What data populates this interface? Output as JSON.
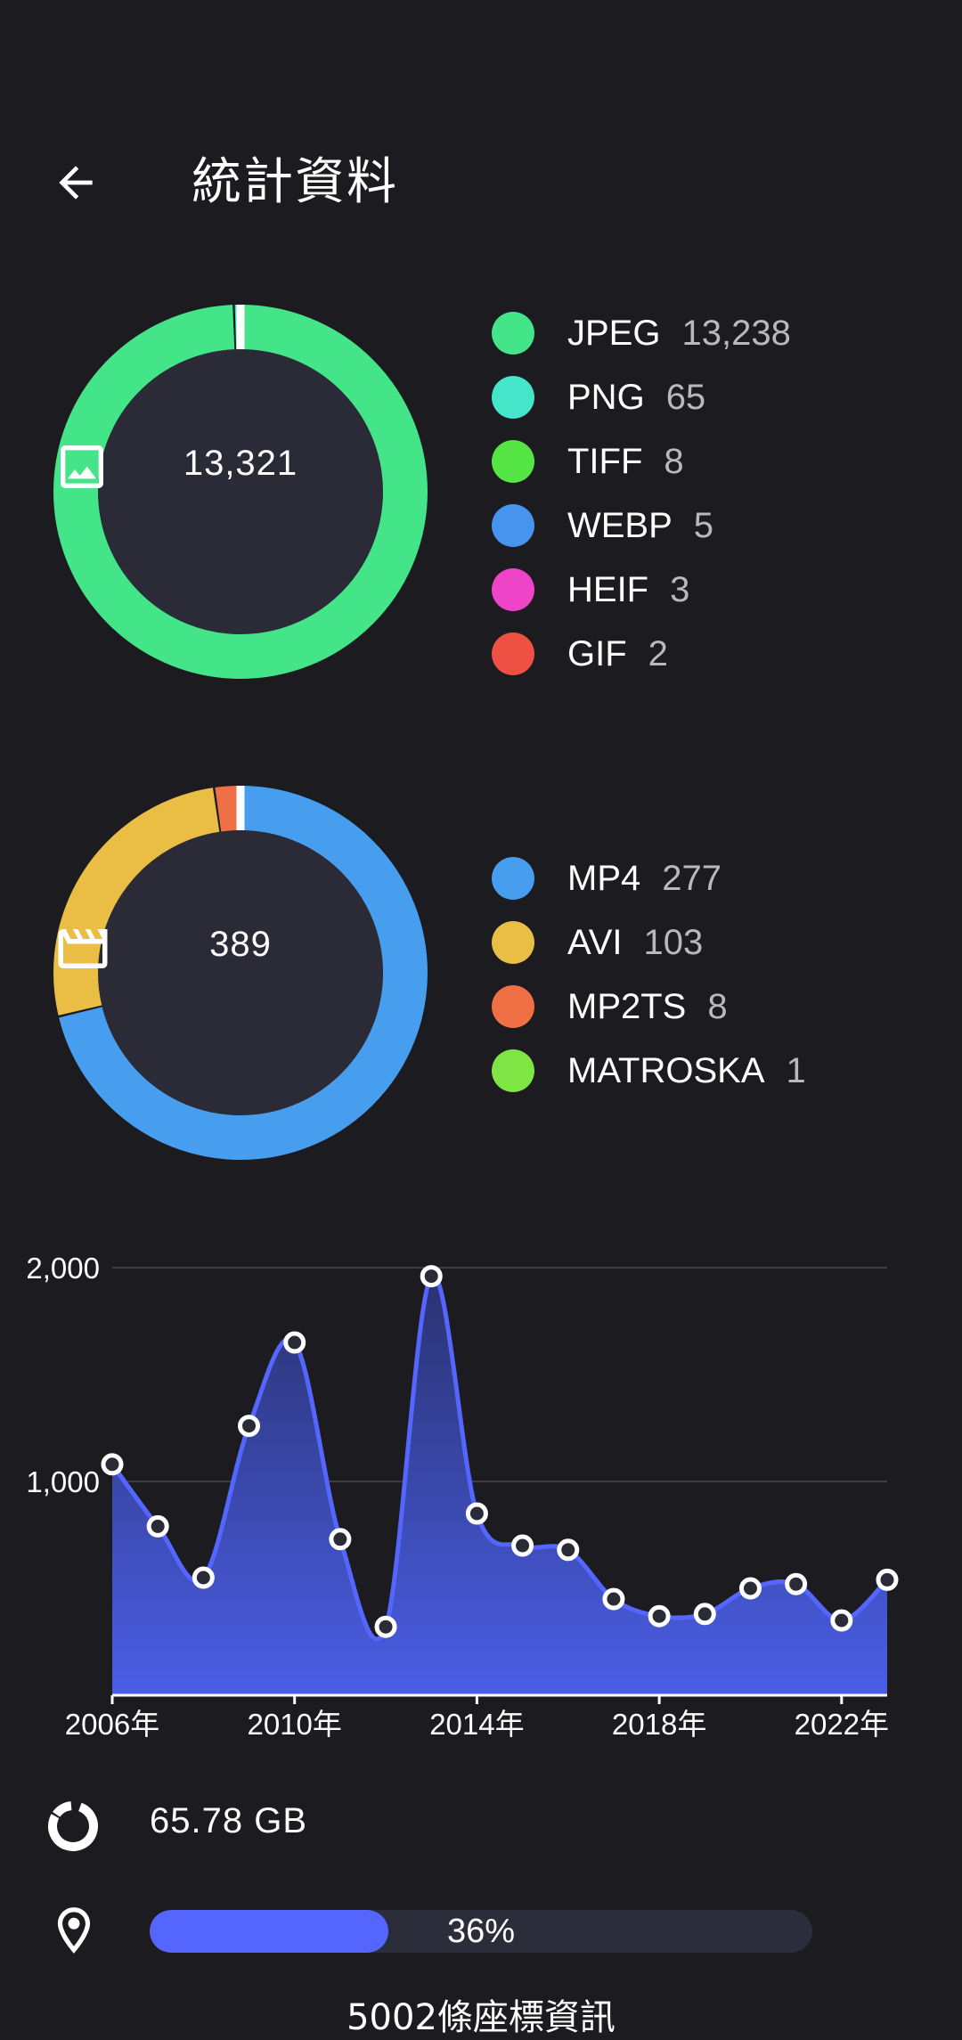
{
  "header": {
    "title": "統計資料",
    "back_icon": "arrow-back-icon"
  },
  "images": {
    "icon": "image-icon",
    "total": "13,321",
    "items": [
      {
        "label": "JPEG",
        "count": "13,238",
        "color": "#44e588"
      },
      {
        "label": "PNG",
        "count": "65",
        "color": "#44e5c8"
      },
      {
        "label": "TIFF",
        "count": "8",
        "color": "#55e544"
      },
      {
        "label": "WEBP",
        "count": "5",
        "color": "#4694ee"
      },
      {
        "label": "HEIF",
        "count": "3",
        "color": "#ee44c8"
      },
      {
        "label": "GIF",
        "count": "2",
        "color": "#ee5044"
      }
    ]
  },
  "videos": {
    "icon": "movie-clapper-icon",
    "total": "389",
    "items": [
      {
        "label": "MP4",
        "count": "277",
        "color": "#489eee"
      },
      {
        "label": "AVI",
        "count": "103",
        "color": "#eabe44"
      },
      {
        "label": "MP2TS",
        "count": "8",
        "color": "#ee7044"
      },
      {
        "label": "MATROSKA",
        "count": "1",
        "color": "#7ee544"
      }
    ]
  },
  "chart_data": {
    "type": "area",
    "x": [
      2006,
      2007,
      2008,
      2009,
      2010,
      2011,
      2012,
      2013,
      2014,
      2015,
      2016,
      2017,
      2018,
      2019,
      2020,
      2021,
      2022,
      2023
    ],
    "y": [
      1080,
      790,
      550,
      1260,
      1650,
      730,
      320,
      1960,
      850,
      700,
      680,
      450,
      370,
      380,
      500,
      520,
      350,
      540
    ],
    "yticks": [
      "1,000",
      "2,000"
    ],
    "ytick_values": [
      1000,
      2000
    ],
    "xticks": [
      "2006年",
      "2010年",
      "2014年",
      "2018年",
      "2022年"
    ],
    "xtick_values": [
      2006,
      2010,
      2014,
      2018,
      2022
    ],
    "ylim": [
      0,
      2000
    ],
    "xlim": [
      2006,
      2023
    ],
    "grid": true,
    "line_color": "#5566ff"
  },
  "storage": {
    "icon": "storage-donut-icon",
    "size": "65.78 GB"
  },
  "location": {
    "icon": "location-pin-icon",
    "progress_percent": 36,
    "progress_label": "36%",
    "caption": "5002條座標資訊"
  }
}
